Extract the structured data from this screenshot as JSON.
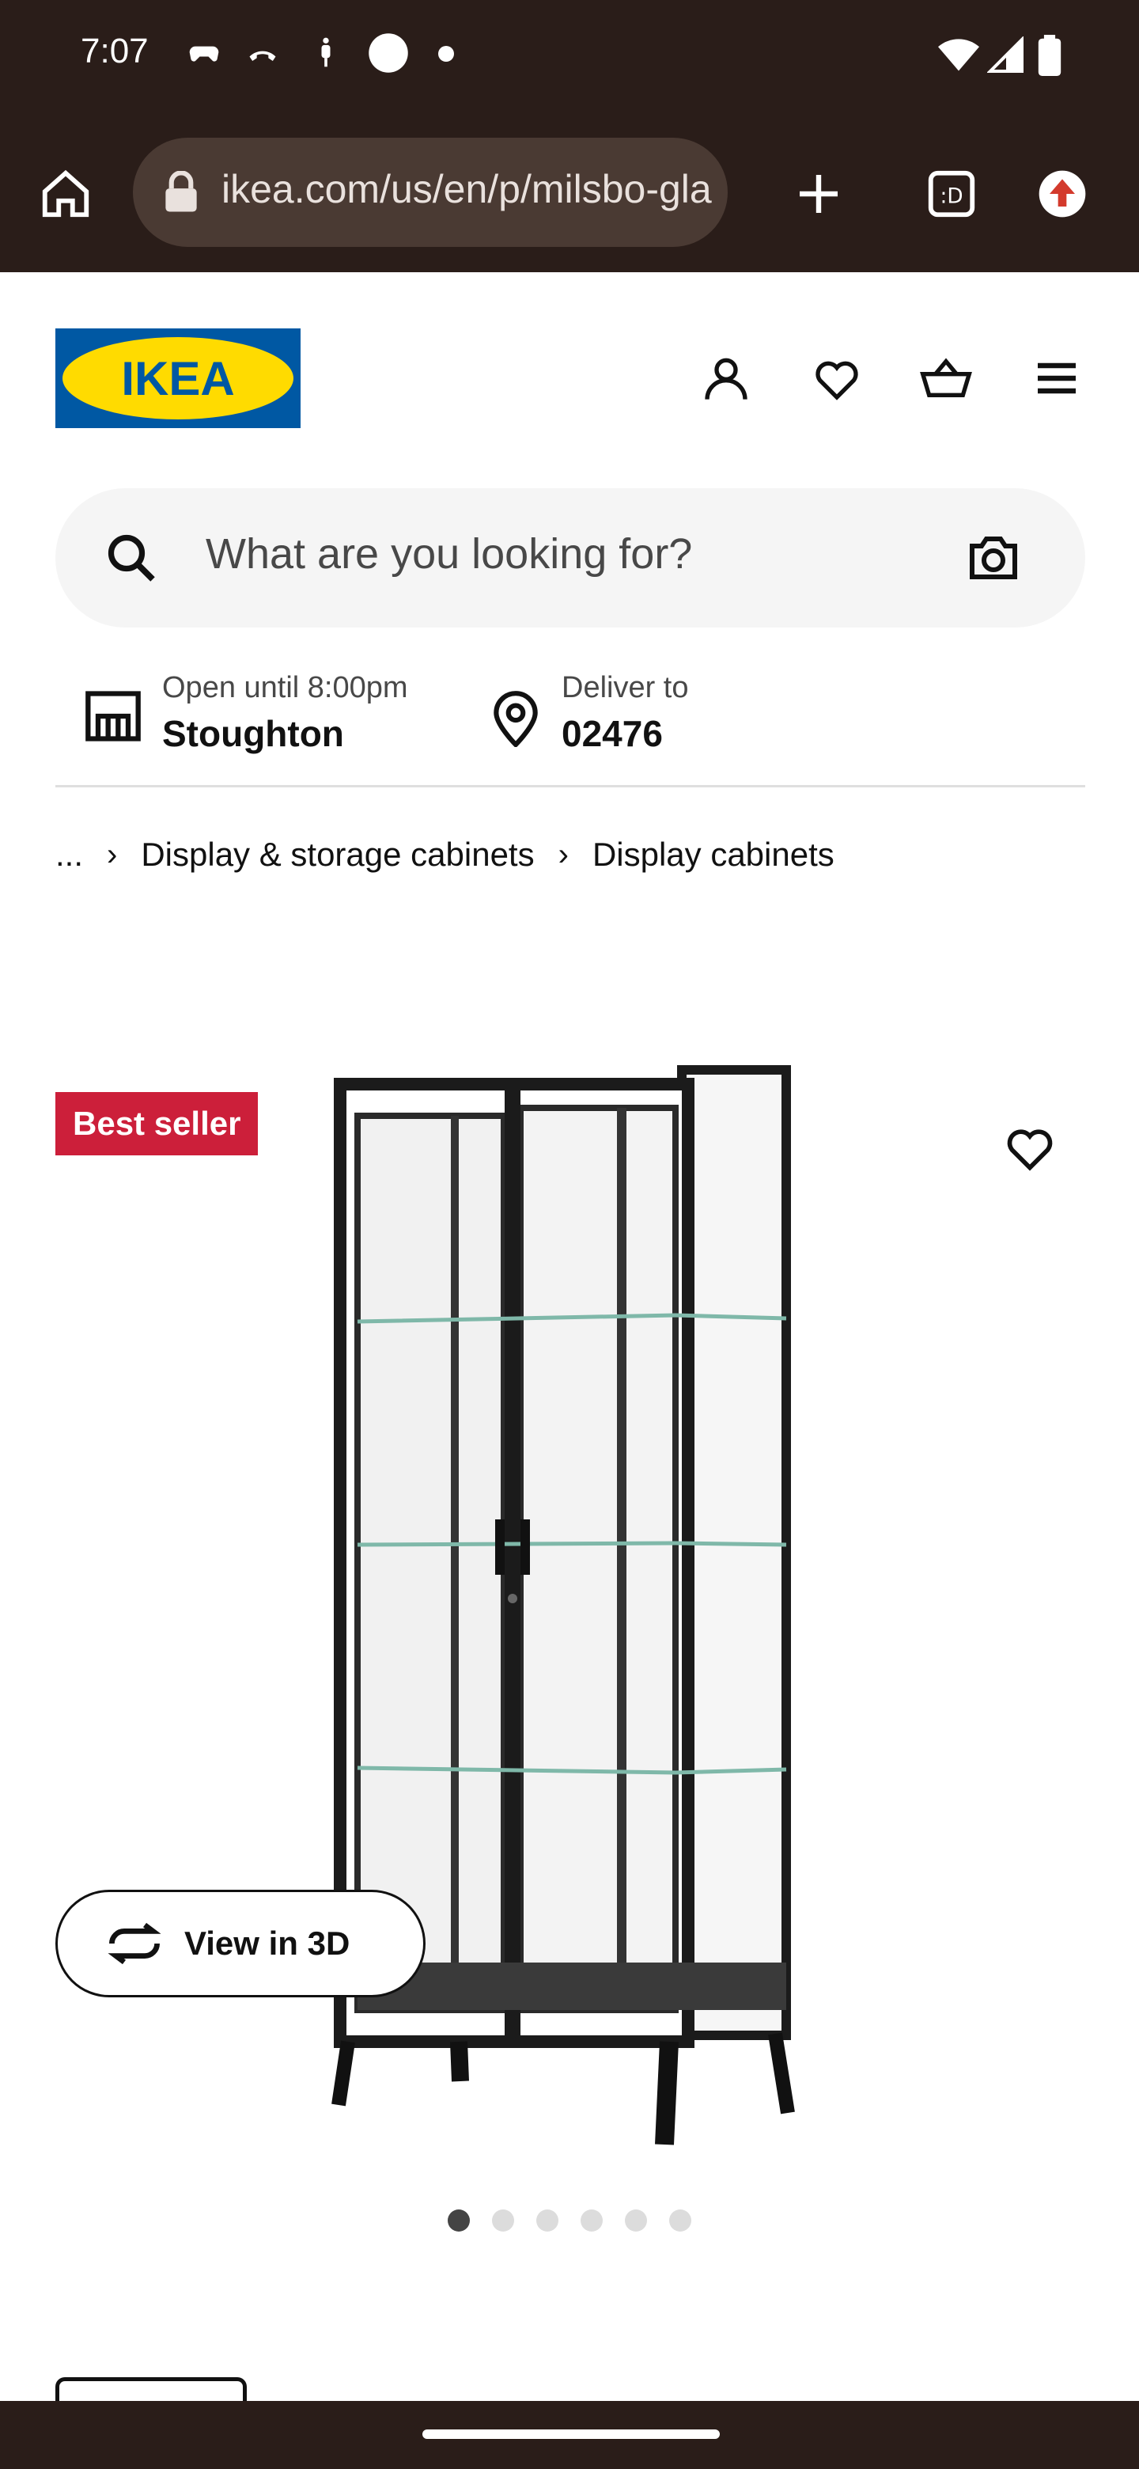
{
  "status_bar": {
    "time": "7:07"
  },
  "browser": {
    "url": "ikea.com/us/en/p/milsbo-glass-door-cabinet"
  },
  "search": {
    "placeholder": "What are you looking for?"
  },
  "store": {
    "hours": "Open until 8:00pm",
    "name": "Stoughton"
  },
  "delivery": {
    "label": "Deliver to",
    "zip": "02476"
  },
  "breadcrumb": {
    "ellipsis": "...",
    "items": [
      "Display & storage cabinets",
      "Display cabinets"
    ]
  },
  "product": {
    "badge": "Best seller",
    "view3d_label": "View in 3D",
    "image_count": 6,
    "active_image": 1
  },
  "colors": {
    "chrome_bg": "#2a1d19",
    "ikea_blue": "#0058a3",
    "ikea_yellow": "#ffdb00",
    "badge_red": "#cc1f3a"
  }
}
